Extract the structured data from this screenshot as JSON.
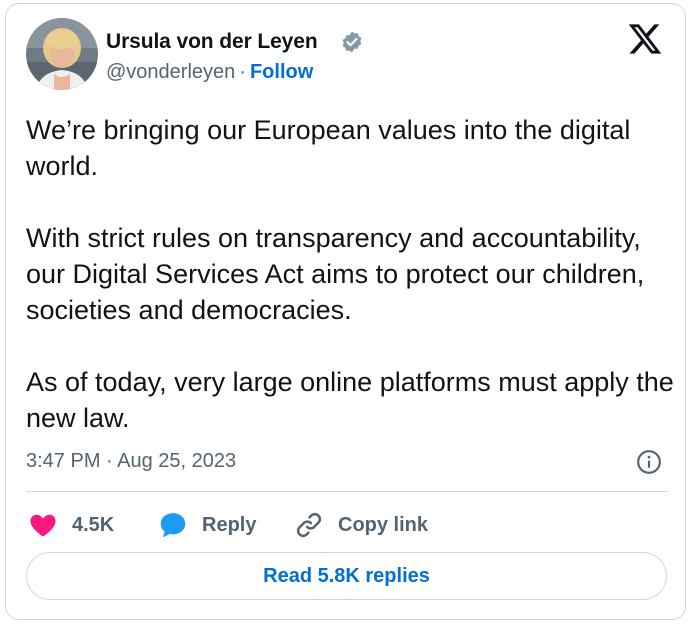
{
  "author": {
    "name": "Ursula von der Leyen",
    "handle": "@vonderleyen",
    "separator": "·",
    "follow_label": "Follow"
  },
  "icons": {
    "verified": "verified-badge-icon",
    "logo": "x-logo-icon",
    "info": "info-icon",
    "like": "heart-icon",
    "reply": "speech-bubble-icon",
    "copy": "link-icon"
  },
  "tweet": {
    "paragraphs": [
      "We’re bringing our European values into the digital world.",
      "With strict rules on transparency and accountability, our Digital Services Act aims to protect our children, societies and democracies.",
      "As of today, very large online platforms must apply the new law."
    ],
    "timestamp": "3:47 PM · Aug 25, 2023"
  },
  "actions": {
    "like_count": "4.5K",
    "reply_label": "Reply",
    "copy_label": "Copy link"
  },
  "footer": {
    "read_replies_label": "Read 5.8K replies"
  },
  "colors": {
    "accent": "#006fd6",
    "like": "#f91880",
    "reply": "#1d9bf0",
    "muted": "#536471",
    "verified": "#829aab"
  }
}
